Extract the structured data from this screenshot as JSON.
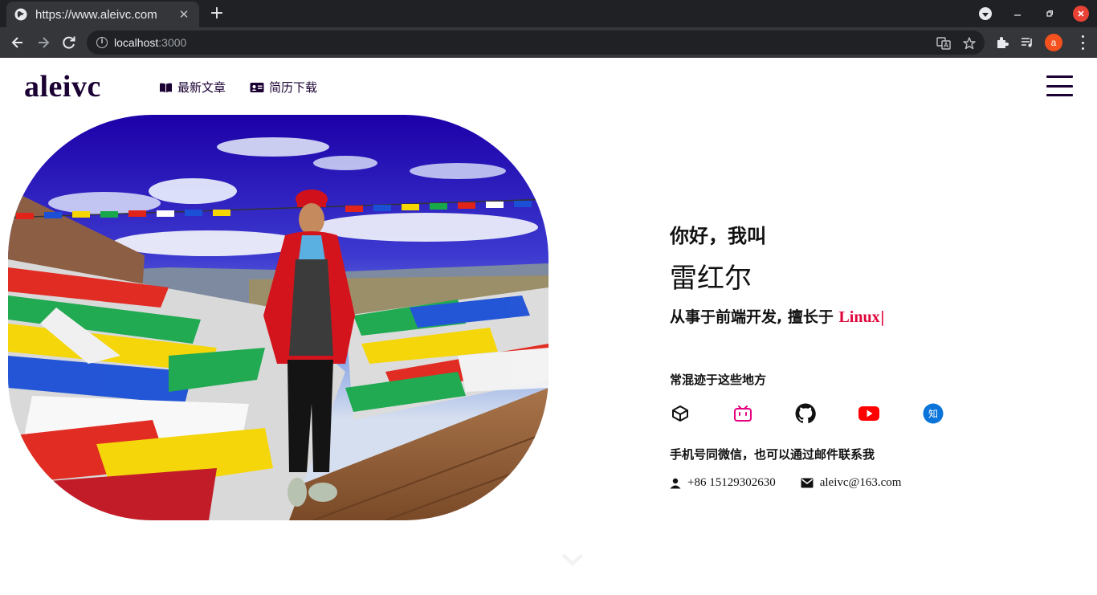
{
  "browser": {
    "tab_title": "https://www.aleivc.com",
    "tab_close": "✕",
    "new_tab": "+",
    "url_host": "localhost",
    "url_port": ":3000",
    "profile_initial": "a"
  },
  "header": {
    "logo": "aleivc",
    "nav": [
      {
        "label": "最新文章",
        "icon": "book-open-icon"
      },
      {
        "label": "简历下载",
        "icon": "id-card-icon"
      }
    ],
    "menu_icon": "hamburger-menu-icon"
  },
  "hero": {
    "photo": "travel-photo-prayer-flags"
  },
  "intro": {
    "greeting": "你好，我叫",
    "name": "雷红尔",
    "role_prefix": "从事于前端开发, 擅长于 ",
    "role_skill": "Linux",
    "cursor": "|",
    "places_title": "常混迹于这些地方",
    "social": [
      {
        "name": "codepen-icon",
        "color": "#111111"
      },
      {
        "name": "bilibili-icon",
        "color": "#e4007f"
      },
      {
        "name": "github-icon",
        "color": "#111111"
      },
      {
        "name": "youtube-icon",
        "color": "#ff0000"
      },
      {
        "name": "zhihu-icon",
        "color": "#0a74da",
        "glyph": "知"
      }
    ],
    "contact_title": "手机号同微信，也可以通过邮件联系我",
    "phone": "+86 15129302630",
    "email": "aleivc@163.com"
  },
  "colors": {
    "brand": "#1b0033",
    "accent": "#e0043b"
  }
}
